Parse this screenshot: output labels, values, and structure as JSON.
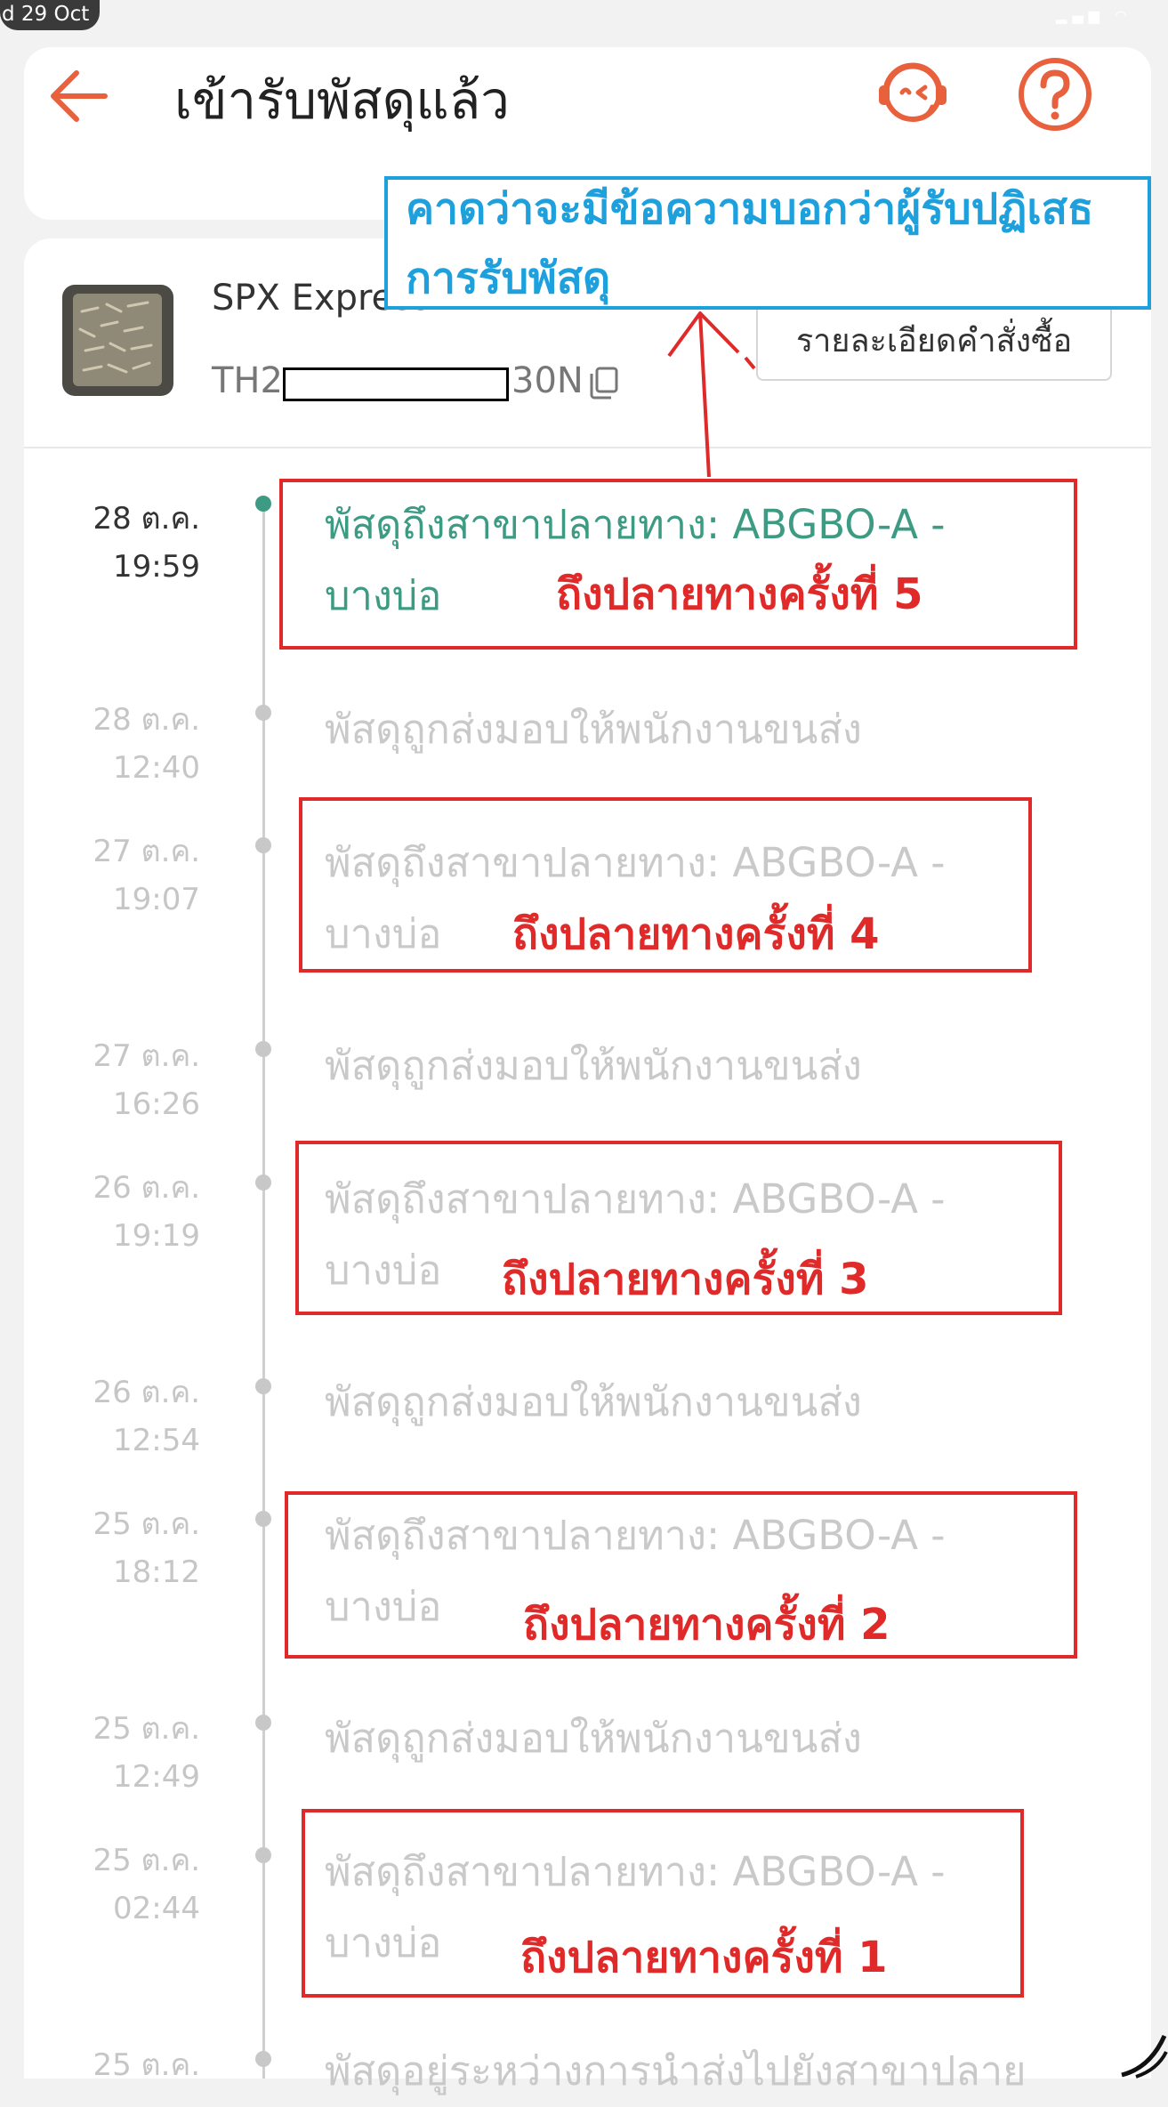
{
  "status_bar": {
    "time": "d 29 Oct"
  },
  "header": {
    "title": "เข้ารับพัสดุแล้ว",
    "back_icon": "arrow-left-icon",
    "support_icon": "headset-support-icon",
    "help_icon": "question-circle-icon"
  },
  "shipment": {
    "carrier": "SPX Express",
    "tracking_prefix": "TH2",
    "tracking_suffix": "30N",
    "order_details_button": "รายละเอียดคำสั่งซื้อ"
  },
  "timeline": [
    {
      "date": "28 ต.ค.",
      "time": "19:59",
      "text": "พัสดุถึงสาขาปลายทาง: ABGBO-A - บางบ่อ",
      "active": true
    },
    {
      "date": "28 ต.ค.",
      "time": "12:40",
      "text": "พัสดุถูกส่งมอบให้พนักงานขนส่ง",
      "active": false
    },
    {
      "date": "27 ต.ค.",
      "time": "19:07",
      "text": "พัสดุถึงสาขาปลายทาง: ABGBO-A - บางบ่อ",
      "active": false
    },
    {
      "date": "27 ต.ค.",
      "time": "16:26",
      "text": "พัสดุถูกส่งมอบให้พนักงานขนส่ง",
      "active": false
    },
    {
      "date": "26 ต.ค.",
      "time": "19:19",
      "text": "พัสดุถึงสาขาปลายทาง: ABGBO-A - บางบ่อ",
      "active": false
    },
    {
      "date": "26 ต.ค.",
      "time": "12:54",
      "text": "พัสดุถูกส่งมอบให้พนักงานขนส่ง",
      "active": false
    },
    {
      "date": "25 ต.ค.",
      "time": "18:12",
      "text": "พัสดุถึงสาขาปลายทาง: ABGBO-A - บางบ่อ",
      "active": false
    },
    {
      "date": "25 ต.ค.",
      "time": "12:49",
      "text": "พัสดุถูกส่งมอบให้พนักงานขนส่ง",
      "active": false
    },
    {
      "date": "25 ต.ค.",
      "time": "02:44",
      "text": "พัสดุถึงสาขาปลายทาง: ABGBO-A - บางบ่อ",
      "active": false
    },
    {
      "date": "25 ต.ค.",
      "time": "",
      "text": "พัสดุอยู่ระหว่างการนำส่งไปยังสาขาปลาย",
      "active": false
    }
  ],
  "annotations": {
    "note": "คาดว่าจะมีข้อความบอกว่าผู้รับปฏิเสธการรับพัสดุ",
    "labels": [
      "ถึงปลายทางครั้งที่ 5",
      "ถึงปลายทางครั้งที่ 4",
      "ถึงปลายทางครั้งที่ 3",
      "ถึงปลายทางครั้งที่ 2",
      "ถึงปลายทางครั้งที่ 1"
    ]
  },
  "colors": {
    "accent": "#e8603c",
    "active_event": "#3d9b84",
    "annotation_red": "#e02a2a",
    "annotation_blue": "#1ea0dd"
  }
}
